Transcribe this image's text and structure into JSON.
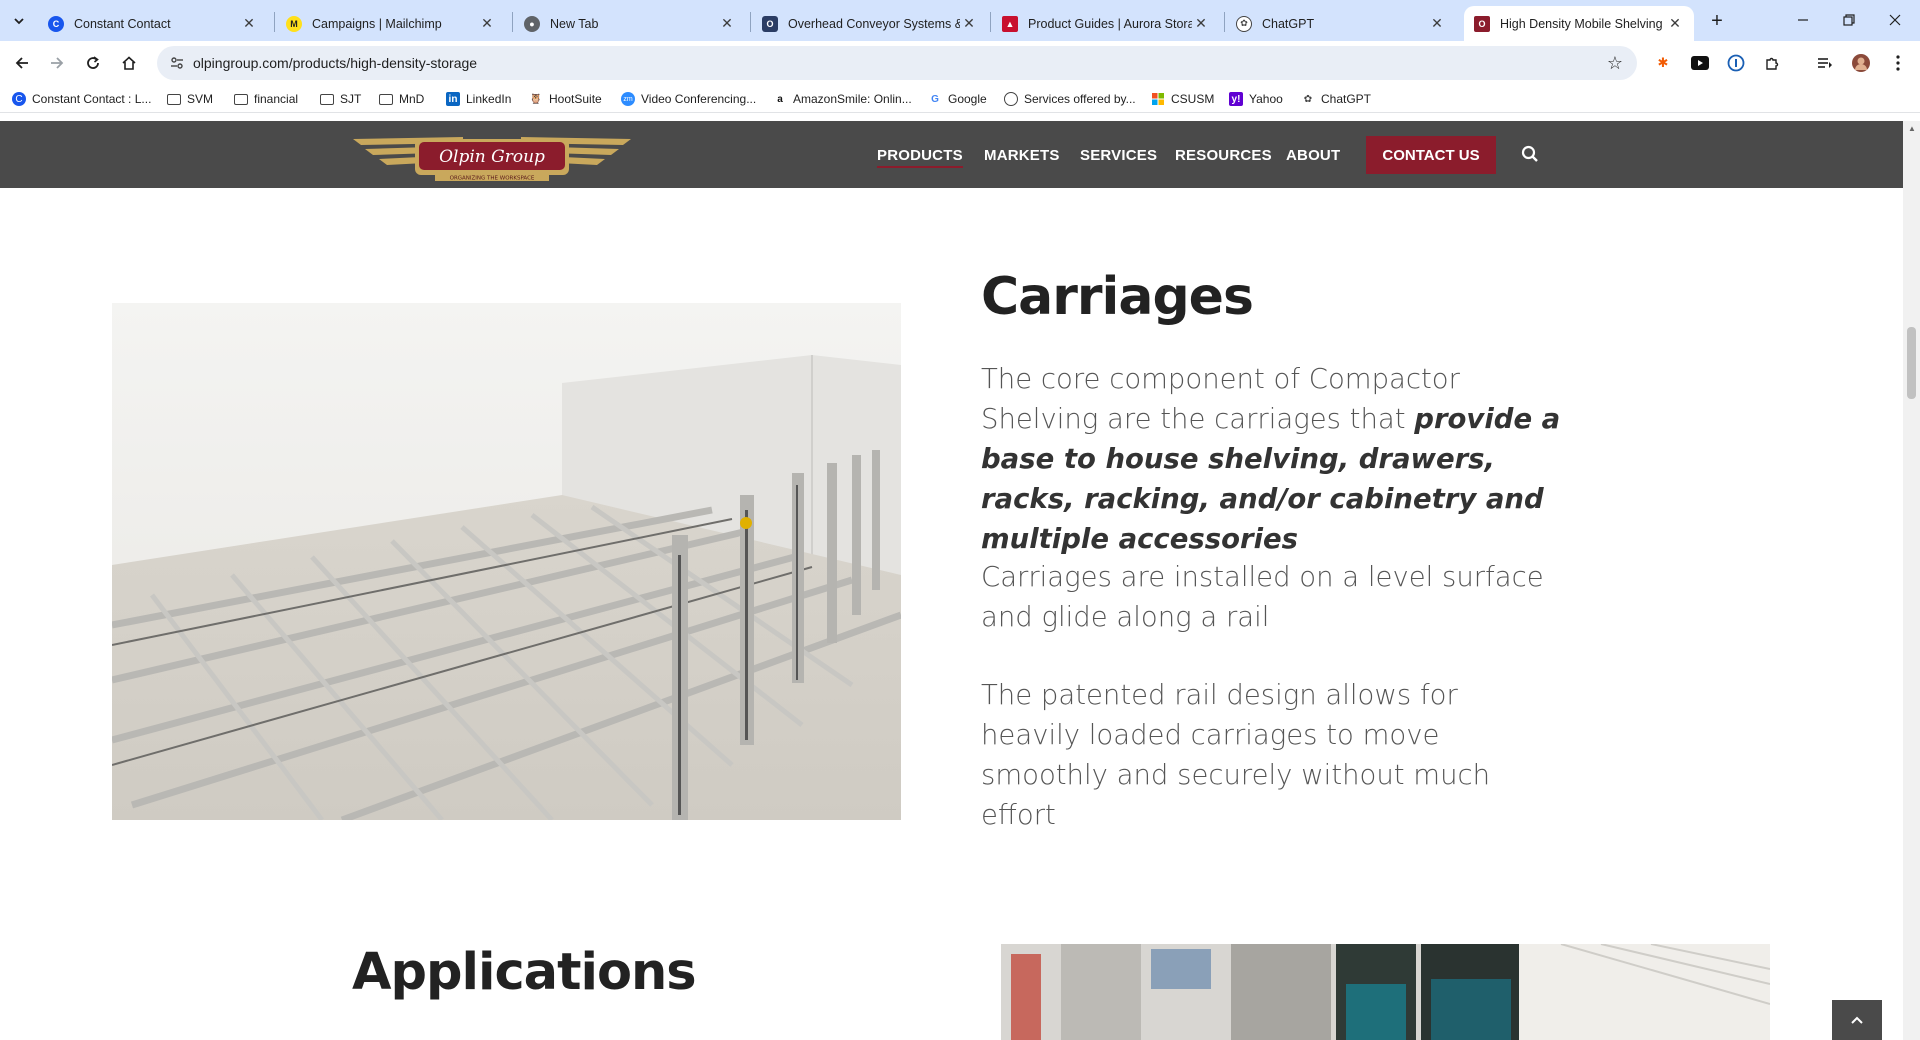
{
  "browser": {
    "tabs": [
      {
        "title": "Constant Contact",
        "icon": "constant-contact-icon",
        "color": "#1856ed"
      },
      {
        "title": "Campaigns | Mailchimp",
        "icon": "mailchimp-icon",
        "color": "#ffe01b"
      },
      {
        "title": "New Tab",
        "icon": "chrome-icon",
        "color": "#5f6368"
      },
      {
        "title": "Overhead Conveyor Systems &",
        "icon": "conveyor-icon",
        "color": "#2b3d64"
      },
      {
        "title": "Product Guides | Aurora Storag",
        "icon": "aurora-icon",
        "color": "#c8102e"
      },
      {
        "title": "ChatGPT",
        "icon": "chatgpt-icon",
        "color": "#444444"
      },
      {
        "title": "High Density Mobile Shelving |",
        "icon": "olpin-icon",
        "color": "#8b1c2c",
        "active": true
      }
    ],
    "url": "olpingroup.com/products/high-density-storage",
    "bookmarks": [
      {
        "label": "Constant Contact : L...",
        "type": "site",
        "icon": "constant-contact-icon"
      },
      {
        "label": "SVM",
        "type": "folder"
      },
      {
        "label": "financial",
        "type": "folder"
      },
      {
        "label": "SJT",
        "type": "folder"
      },
      {
        "label": "MnD",
        "type": "folder"
      },
      {
        "label": "LinkedIn",
        "type": "site",
        "icon": "linkedin-icon"
      },
      {
        "label": "HootSuite",
        "type": "site",
        "icon": "hootsuite-icon"
      },
      {
        "label": "Video Conferencing...",
        "type": "site",
        "icon": "zoom-icon"
      },
      {
        "label": "AmazonSmile: Onlin...",
        "type": "site",
        "icon": "amazon-icon"
      },
      {
        "label": "Google",
        "type": "site",
        "icon": "google-icon"
      },
      {
        "label": "Services offered by...",
        "type": "site",
        "icon": "globe-icon"
      },
      {
        "label": "CSUSM",
        "type": "site",
        "icon": "microsoft-icon"
      },
      {
        "label": "Yahoo",
        "type": "site",
        "icon": "yahoo-icon"
      },
      {
        "label": "ChatGPT",
        "type": "site",
        "icon": "chatgpt-icon"
      }
    ]
  },
  "site": {
    "logo_text": "Olpin Group",
    "logo_tagline": "ORGANIZING THE WORKSPACE",
    "nav": [
      "PRODUCTS",
      "MARKETS",
      "SERVICES",
      "RESOURCES",
      "ABOUT"
    ],
    "contact": "CONTACT US",
    "brand_color": "#8b1c2c"
  },
  "carriages": {
    "title": "Carriages",
    "p1_plain": "The core component of Compactor Shelving are the carriages that ",
    "p1_bold": "provide a base to house shelving, drawers, racks, racking, and/or cabinetry and multiple accessories",
    "p2": "Carriages are installed on a level surface and glide along a rail",
    "p3": "The patented rail design allows for heavily loaded carriages to move smoothly and securely without much effort"
  },
  "applications": {
    "title": "Applications"
  }
}
